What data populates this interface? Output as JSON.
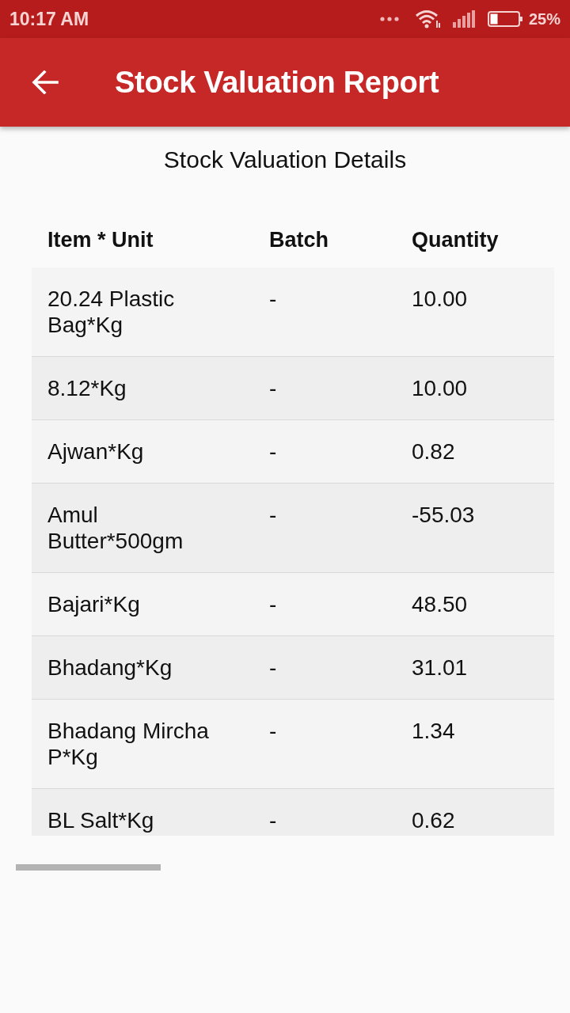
{
  "status_bar": {
    "time": "10:17 AM",
    "battery": "25%"
  },
  "app_bar": {
    "title": "Stock Valuation Report"
  },
  "subtitle": "Stock Valuation Details",
  "table": {
    "columns": [
      "Item * Unit",
      "Batch",
      "Quantity"
    ],
    "rows": [
      {
        "cells": [
          "20.24 Plastic Bag*Kg",
          "-",
          "10.00"
        ]
      },
      {
        "cells": [
          "8.12*Kg",
          "-",
          "10.00"
        ]
      },
      {
        "cells": [
          "Ajwan*Kg",
          "-",
          "0.82"
        ]
      },
      {
        "cells": [
          "Amul Butter*500gm",
          "-",
          "-55.03"
        ]
      },
      {
        "cells": [
          "Bajari*Kg",
          "-",
          "48.50"
        ]
      },
      {
        "cells": [
          "Bhadang*Kg",
          "-",
          "31.01"
        ]
      },
      {
        "cells": [
          "Bhadang Mircha P*Kg",
          "-",
          "1.34"
        ]
      },
      {
        "cells": [
          "BL Salt*Kg",
          "-",
          "0.62"
        ]
      }
    ]
  }
}
